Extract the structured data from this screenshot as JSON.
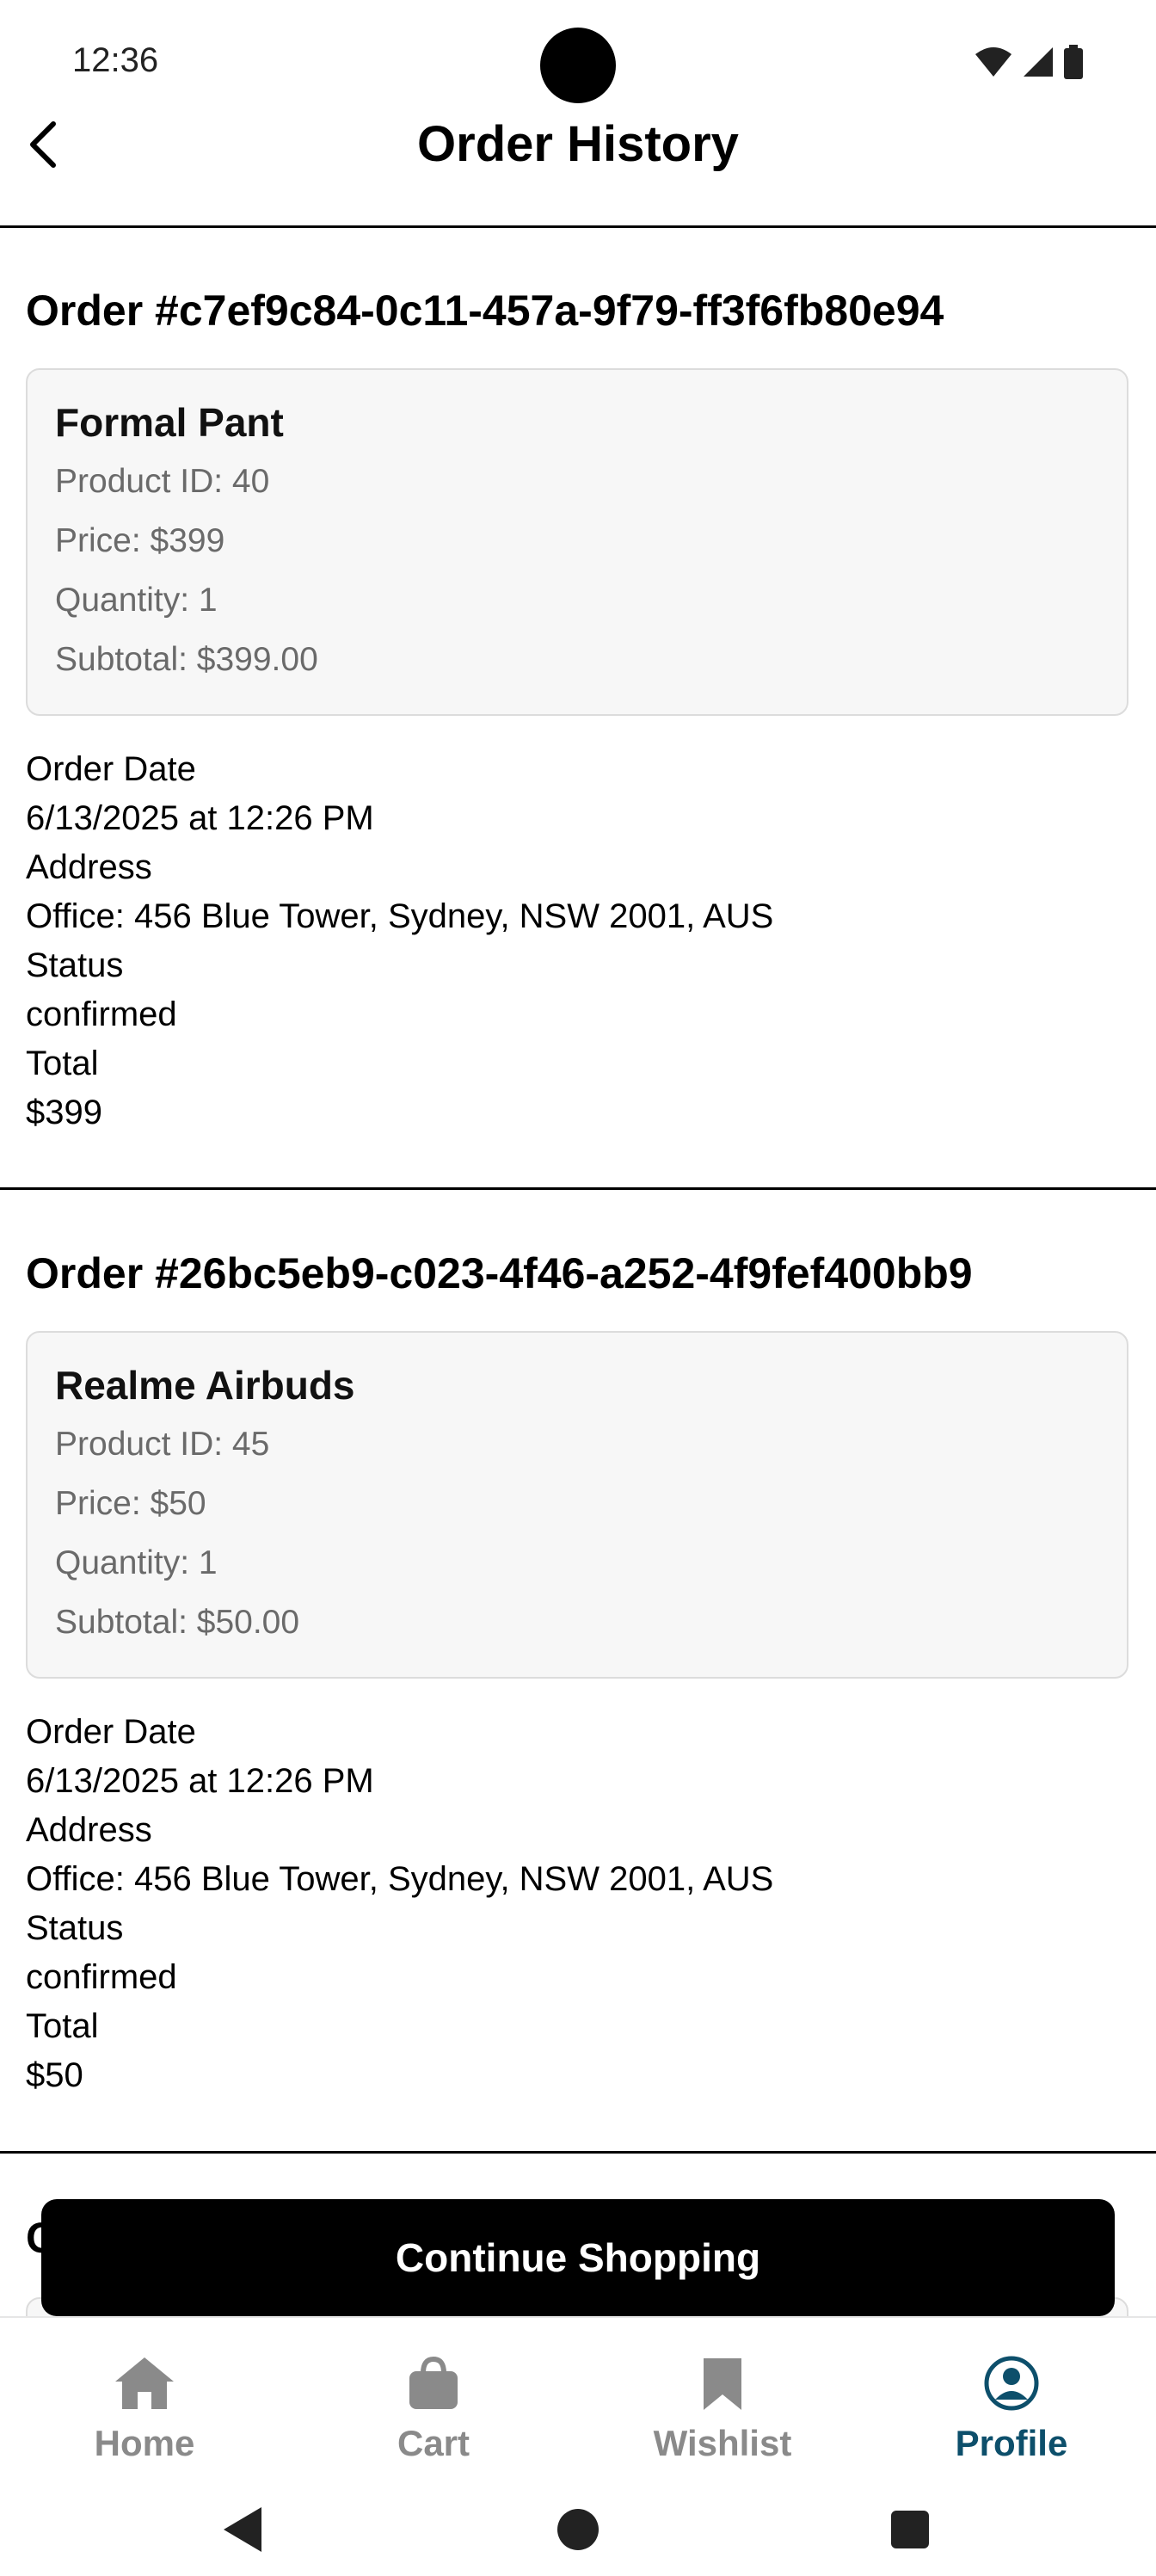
{
  "status_bar": {
    "time": "12:36"
  },
  "header": {
    "title": "Order History"
  },
  "orders": [
    {
      "id_label": "Order #c7ef9c84-0c11-457a-9f79-ff3f6fb80e94",
      "item": {
        "name": "Formal Pant",
        "product_id": "Product ID: 40",
        "price": "Price: $399",
        "quantity": "Quantity: 1",
        "subtotal": "Subtotal: $399.00"
      },
      "order_date_label": "Order Date",
      "order_date": "6/13/2025 at 12:26 PM",
      "address_label": "Address",
      "address": "Office: 456 Blue Tower, Sydney, NSW 2001, AUS",
      "status_label": "Status",
      "status": "confirmed",
      "total_label": "Total",
      "total": "$399"
    },
    {
      "id_label": "Order #26bc5eb9-c023-4f46-a252-4f9fef400bb9",
      "item": {
        "name": "Realme Airbuds",
        "product_id": "Product ID: 45",
        "price": "Price: $50",
        "quantity": "Quantity: 1",
        "subtotal": "Subtotal: $50.00"
      },
      "order_date_label": "Order Date",
      "order_date": "6/13/2025 at 12:26 PM",
      "address_label": "Address",
      "address": "Office: 456 Blue Tower, Sydney, NSW 2001, AUS",
      "status_label": "Status",
      "status": "confirmed",
      "total_label": "Total",
      "total": "$50"
    }
  ],
  "peek_text": "C",
  "continue_button": "Continue Shopping",
  "bottom_nav": [
    {
      "label": "Home",
      "icon": "home-icon",
      "active": false
    },
    {
      "label": "Cart",
      "icon": "bag-icon",
      "active": false
    },
    {
      "label": "Wishlist",
      "icon": "bookmark-icon",
      "active": false
    },
    {
      "label": "Profile",
      "icon": "profile-icon",
      "active": true
    }
  ],
  "colors": {
    "accent": "#0d4f6b",
    "inactive": "#8a8a8a",
    "card_bg": "#f7f7f7",
    "card_border": "#dcdcdc"
  }
}
